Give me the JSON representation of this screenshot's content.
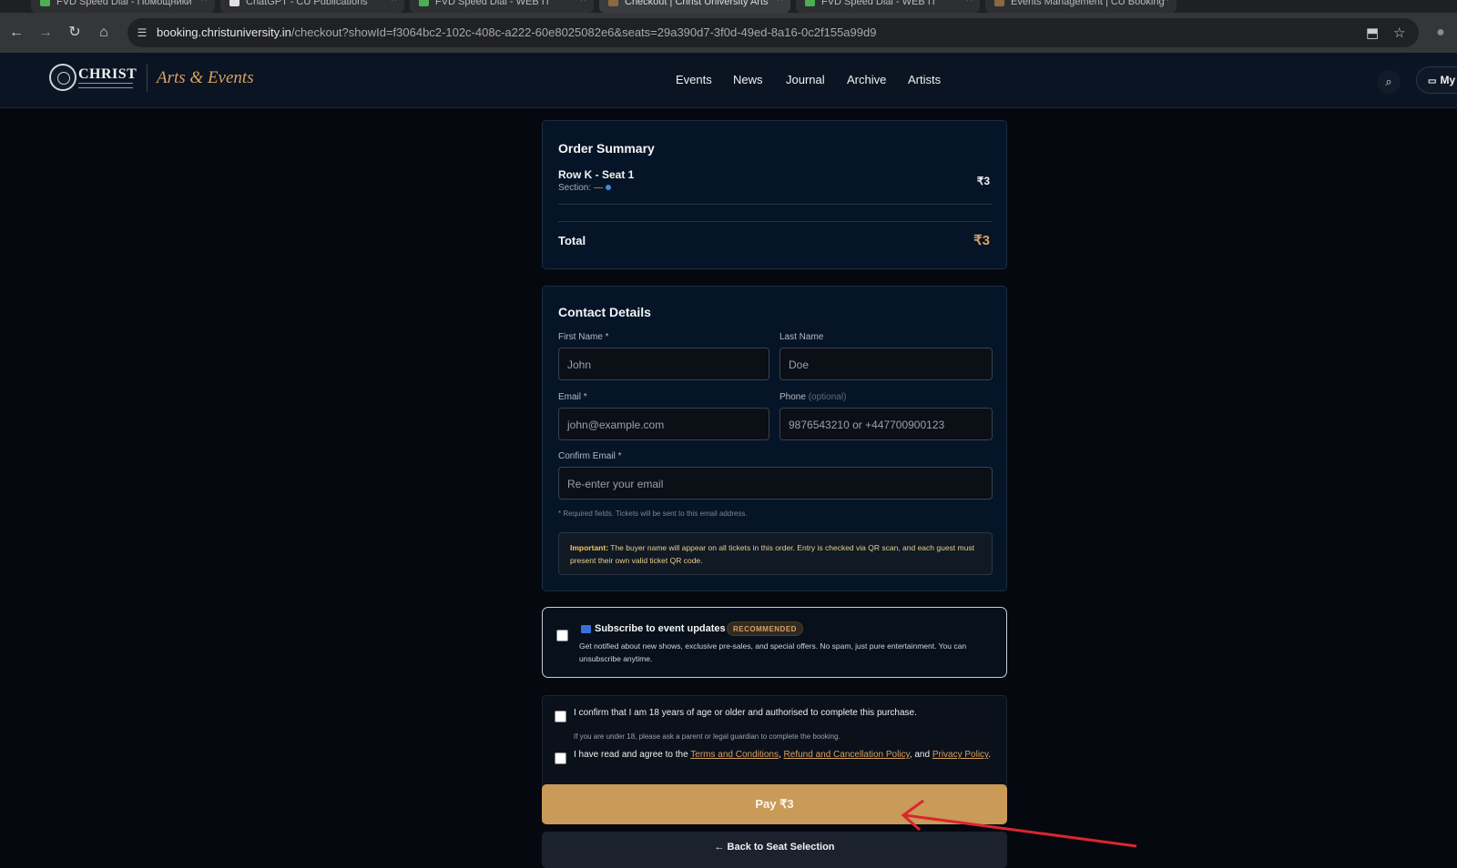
{
  "browser": {
    "tabs": [
      {
        "title": "FVD Speed Dial - Помощники",
        "active": false
      },
      {
        "title": "ChatGPT - CU Publications",
        "active": false
      },
      {
        "title": "FVD Speed Dial - WEB IT",
        "active": false
      },
      {
        "title": "Checkout | Christ University Arts",
        "active": true
      },
      {
        "title": "FVD Speed Dial - WEB IT",
        "active": false
      },
      {
        "title": "Events Management | CU Booking",
        "active": false
      }
    ],
    "url_host": "booking.christuniversity.in",
    "url_path": "/checkout?showId=f3064bc2-102c-408c-a222-60e8025082e6&seats=29a390d7-3f0d-49ed-8a16-0c2f155a99d9"
  },
  "site": {
    "logo_text": "CHRIST",
    "brand": "Arts & Events",
    "nav": [
      "Events",
      "News",
      "Journal",
      "Archive",
      "Artists"
    ],
    "my_label": "My"
  },
  "order": {
    "title": "Order Summary",
    "seat": "Row K - Seat 1",
    "section_label": "Section:",
    "section_value": "—",
    "seat_price": "₹3",
    "total_label": "Total",
    "total_value": "₹3"
  },
  "contact": {
    "title": "Contact Details",
    "first_name_label": "First Name *",
    "first_name_placeholder": "John",
    "last_name_label": "Last Name",
    "last_name_placeholder": "Doe",
    "email_label": "Email *",
    "email_placeholder": "john@example.com",
    "phone_label": "Phone",
    "phone_optional": "(optional)",
    "phone_placeholder": "9876543210 or +447700900123",
    "confirm_email_label": "Confirm Email *",
    "confirm_email_placeholder": "Re-enter your email",
    "required_note": "* Required fields. Tickets will be sent to this email address.",
    "important_label": "Important:",
    "important_text": "The buyer name will appear on all tickets in this order. Entry is checked via QR scan, and each guest must present their own valid ticket QR code."
  },
  "subscribe": {
    "title": "Subscribe to event updates",
    "badge": "RECOMMENDED",
    "text": "Get notified about new shows, exclusive pre-sales, and special offers. No spam, just pure entertainment. You can unsubscribe anytime.",
    "checked": false
  },
  "confirmations": {
    "age_text": "I confirm that I am 18 years of age or older and authorised to complete this purchase.",
    "age_note": "If you are under 18, please ask a parent or legal guardian to complete the booking.",
    "terms_prefix": "I have read and agree to the",
    "terms_link": "Terms and Conditions",
    "comma": ",",
    "refund_link": "Refund and Cancellation Policy",
    "and_text": ", and",
    "privacy_link": "Privacy Policy",
    "period": "."
  },
  "actions": {
    "pay_label": "Pay ₹3",
    "back_label": "← Back to Seat Selection"
  },
  "colors": {
    "accent": "#d9a15f",
    "pay_button": "#c99a58",
    "annotation_arrow": "#d9262e"
  },
  "annotation": {
    "icon": "red-arrow-pointing-at-pay-button"
  }
}
